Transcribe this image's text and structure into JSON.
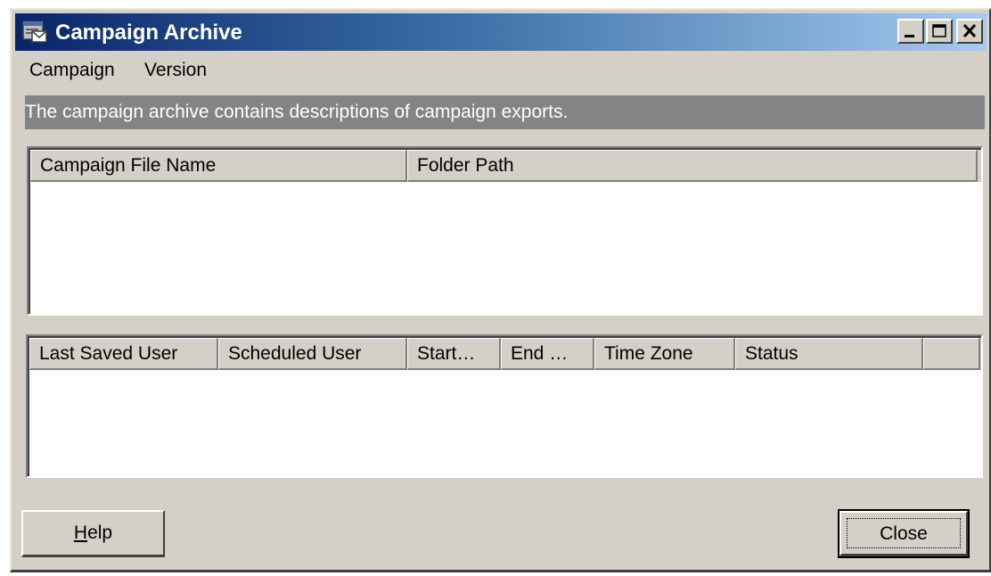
{
  "window": {
    "title": "Campaign Archive",
    "icon": "campaign-archive-icon",
    "controls": {
      "minimize_icon": "minimize-icon",
      "maximize_icon": "maximize-icon",
      "close_icon": "close-icon"
    }
  },
  "menu": {
    "items": [
      {
        "label": "Campaign"
      },
      {
        "label": "Version"
      }
    ]
  },
  "description": "The campaign archive contains descriptions of campaign exports.",
  "campaign_list": {
    "columns": [
      {
        "label": "Campaign File Name"
      },
      {
        "label": "Folder Path"
      }
    ],
    "rows": []
  },
  "version_list": {
    "columns": [
      {
        "label": "Last Saved User"
      },
      {
        "label": "Scheduled User"
      },
      {
        "label": "Start…"
      },
      {
        "label": "End …"
      },
      {
        "label": "Time Zone"
      },
      {
        "label": "Status"
      },
      {
        "label": ""
      }
    ],
    "rows": []
  },
  "buttons": {
    "help_label": "Help",
    "help_mnemonic": "H",
    "help_rest": "elp",
    "close_label": "Close"
  },
  "colors": {
    "title_gradient_start": "#0a246a",
    "title_gradient_end": "#a6caf0",
    "face": "#d4d0c8",
    "description_bar": "#848484"
  }
}
